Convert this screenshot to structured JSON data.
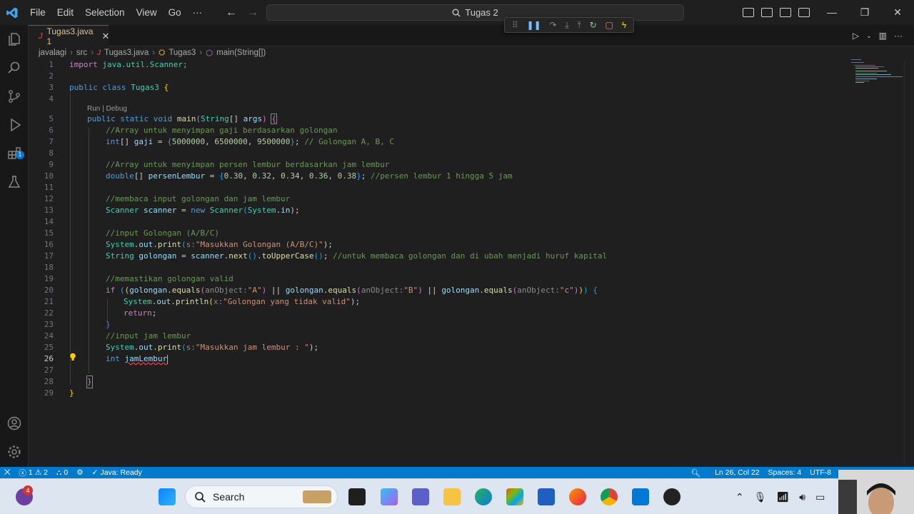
{
  "menu": [
    "File",
    "Edit",
    "Selection",
    "View",
    "Go",
    "···"
  ],
  "command_center": {
    "label": "Tugas 2"
  },
  "tab": {
    "label": "Tugas3.java 1",
    "icon": "J",
    "close": "✕"
  },
  "breadcrumb": [
    "javalagi",
    "src",
    "Tugas3.java",
    "Tugas3",
    "main(String[])"
  ],
  "codelens": "Run | Debug",
  "line_numbers": [
    "1",
    "2",
    "3",
    "4",
    "5",
    "6",
    "7",
    "8",
    "9",
    "10",
    "11",
    "12",
    "13",
    "14",
    "15",
    "16",
    "17",
    "18",
    "19",
    "20",
    "21",
    "22",
    "23",
    "24",
    "25",
    "26",
    "27",
    "28",
    "29"
  ],
  "active_line": "26",
  "code": {
    "l1": [
      "import",
      " java.util.Scanner;"
    ],
    "l3": [
      "public",
      " ",
      "class",
      " ",
      "Tugas3",
      " ",
      "{"
    ],
    "l5": [
      "public",
      " ",
      "static",
      " ",
      "void",
      " ",
      "main",
      "(",
      "String",
      "[] ",
      "args",
      ") ",
      "{"
    ],
    "l6": "//Array untuk menyimpan gaji berdasarkan golongan",
    "l7": [
      "int",
      "[] ",
      "gaji",
      " = ",
      "{",
      "5000000",
      ", ",
      "6500000",
      ", ",
      "9500000",
      "}",
      "; ",
      "// Golongan A, B, C"
    ],
    "l9": "//Array untuk menyimpan persen lembur berdasarkan jam lembur",
    "l10": [
      "double",
      "[] ",
      "persenLembur",
      " = ",
      "{",
      "0.30",
      ", ",
      "0.32",
      ", ",
      "0.34",
      ", ",
      "0.36",
      ", ",
      "0.38",
      "}",
      "; ",
      "//persen lembur 1 hingga 5 jam"
    ],
    "l12": "//membaca input golongan dan jam lembur",
    "l13": [
      "Scanner",
      " ",
      "scanner",
      " = ",
      "new",
      " ",
      "Scanner",
      "(",
      "System",
      ".",
      "in",
      ");"
    ],
    "l15": "//input Golongan (A/B/C)",
    "l16": [
      "System",
      ".",
      "out",
      ".",
      "print",
      "(",
      "s:",
      "\"Masukkan Golongan (A/B/C)\"",
      ");"
    ],
    "l17": [
      "String",
      " ",
      "golongan",
      " = ",
      "scanner",
      ".",
      "next",
      "()",
      ".",
      "toUpperCase",
      "()",
      "; ",
      "//untuk membaca golongan dan di ubah menjadi huruf kapital"
    ],
    "l19": "//memastikan golongan valid",
    "l20": [
      "if",
      " ",
      "(",
      "(",
      "golongan",
      ".",
      "equals",
      "(",
      "anObject:",
      "\"A\"",
      ")",
      " || ",
      "golongan",
      ".",
      "equals",
      "(",
      "anObject:",
      "\"B\"",
      ")",
      " || ",
      "golongan",
      ".",
      "equals",
      "(",
      "anObject:",
      "\"c\"",
      ")",
      ")",
      ")",
      " ",
      "{"
    ],
    "l21": [
      "System",
      ".",
      "out",
      ".",
      "println",
      "(",
      "x:",
      "\"Golongan yang tidak valid\"",
      ");"
    ],
    "l22": [
      "return",
      ";"
    ],
    "l23": "}",
    "l24": "//input jam lembur",
    "l25": [
      "System",
      ".",
      "out",
      ".",
      "print",
      "(",
      "s:",
      "\"Masukkan jam lembur : \"",
      ");"
    ],
    "l26": [
      "int",
      " ",
      "jamLembur"
    ],
    "l28": "}",
    "l29": "}"
  },
  "status": {
    "remote": "⨉",
    "problems_errors": "1",
    "problems_warnings": "2",
    "ports": "0",
    "java": "Java: Ready",
    "position": "Ln 26, Col 22",
    "spaces": "Spaces: 4",
    "encoding": "UTF-8"
  },
  "taskbar": {
    "search_label": "Search",
    "notification_count": "4"
  },
  "colors": {
    "accent": "#007acc",
    "editor_bg": "#1f1f1f",
    "keyword": "#569cd6",
    "comment": "#6a9955",
    "string": "#ce9178"
  }
}
